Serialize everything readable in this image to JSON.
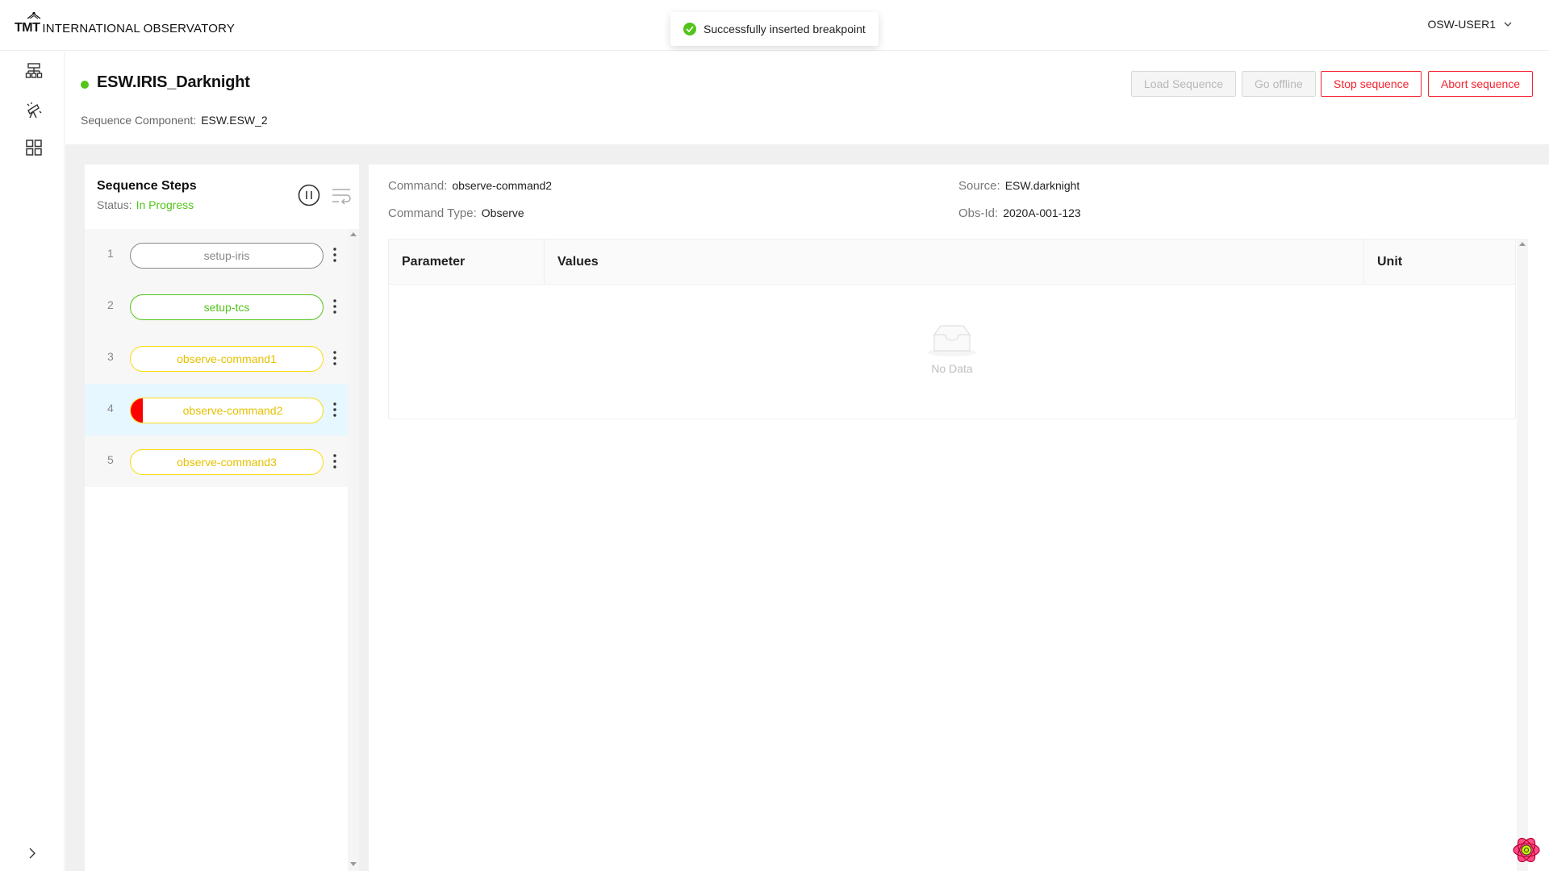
{
  "header": {
    "logo_mark": "TMT",
    "logo_text": "INTERNATIONAL OBSERVATORY",
    "user": "OSW-USER1"
  },
  "toast": {
    "message": "Successfully inserted breakpoint"
  },
  "sidebar": {
    "items": [
      {
        "icon": "sitemap-icon"
      },
      {
        "icon": "telescope-icon"
      },
      {
        "icon": "grid-icon"
      }
    ],
    "collapse_icon": "chevron-right-icon"
  },
  "sequencer": {
    "title": "ESW.IRIS_Darknight",
    "status_color": "#52c41a",
    "component_label": "Sequence Component:",
    "component_value": "ESW.ESW_2"
  },
  "actions": {
    "load": "Load Sequence",
    "offline": "Go offline",
    "stop": "Stop sequence",
    "abort": "Abort sequence"
  },
  "steps": {
    "title": "Sequence Steps",
    "status_label": "Status:",
    "status_value": "In Progress",
    "items": [
      {
        "num": "1",
        "name": "setup-iris",
        "color": "#888888",
        "text_color": "#888888"
      },
      {
        "num": "2",
        "name": "setup-tcs",
        "color": "#52c41a",
        "text_color": "#52c41a"
      },
      {
        "num": "3",
        "name": "observe-command1",
        "color": "#fadb14",
        "text_color": "#e5c100"
      },
      {
        "num": "4",
        "name": "observe-command2",
        "color": "#fadb14",
        "text_color": "#e5c100",
        "breakpoint": true,
        "selected": true
      },
      {
        "num": "5",
        "name": "observe-command3",
        "color": "#fadb14",
        "text_color": "#e5c100"
      }
    ]
  },
  "details": {
    "command_label": "Command:",
    "command_value": "observe-command2",
    "type_label": "Command Type:",
    "type_value": "Observe",
    "source_label": "Source:",
    "source_value": "ESW.darknight",
    "obsid_label": "Obs-Id:",
    "obsid_value": "2020A-001-123",
    "table": {
      "columns": [
        "Parameter",
        "Values",
        "Unit"
      ],
      "empty_text": "No Data"
    }
  },
  "colors": {
    "danger": "#f5222d",
    "success": "#52c41a",
    "warning": "#fadb14",
    "selected_accent": "#2f54eb",
    "breakpoint": "#ff0000"
  }
}
